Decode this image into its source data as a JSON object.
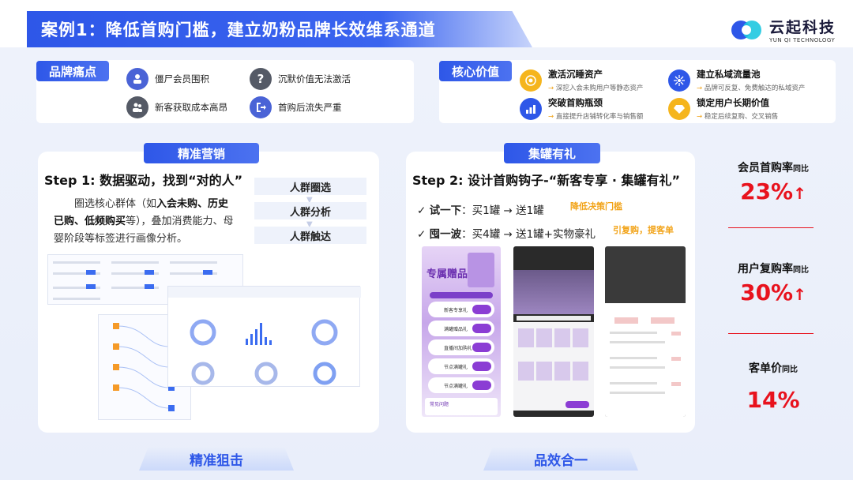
{
  "header": {
    "title": "案例1：降低首购门槛，建立奶粉品牌长效维系通道",
    "logo_cn": "云起科技",
    "logo_en": "YUN QI TECHNOLOGY"
  },
  "pain_points": {
    "label": "品牌痛点",
    "items": [
      {
        "text": "僵尸会员围积",
        "icon": "member-icon",
        "color": "#4a63d6"
      },
      {
        "text": "沉默价值无法激活",
        "icon": "question-icon",
        "color": "#555a66"
      },
      {
        "text": "新客获取成本高昂",
        "icon": "users-icon",
        "color": "#555a66"
      },
      {
        "text": "首购后流失严重",
        "icon": "exit-icon",
        "color": "#4a63d6"
      }
    ]
  },
  "core_value": {
    "label": "核心价值",
    "items": [
      {
        "title": "激活沉睡资产",
        "sub": "深挖入会未购用户等静态资产",
        "icon": "target-icon",
        "color": "#f5b51d"
      },
      {
        "title": "建立私域流量池",
        "sub": "品牌可反复、免费触达的私域资产",
        "icon": "network-icon",
        "color": "#2e57e8"
      },
      {
        "title": "突破首购瓶颈",
        "sub": "直接提升店铺转化率与销售额",
        "icon": "chart-icon",
        "color": "#2e57e8"
      },
      {
        "title": "锁定用户长期价值",
        "sub": "稳定后续复购、交叉销售",
        "icon": "diamond-icon",
        "color": "#f5b51d"
      }
    ],
    "arrow": "→"
  },
  "left_panel": {
    "tag": "精准营销",
    "step": "Step 1: 数据驱动，找到“对的人”",
    "desc_lines": [
      "圈选核心群体（如",
      "入会未购、历史",
      "已购、低频购买",
      "等），叠加消费能力、母婴阶段等标签进行画像分析。"
    ],
    "flow": [
      "人群圈选",
      "人群分析",
      "人群触达"
    ],
    "bottom": "精准狙击"
  },
  "right_panel": {
    "tag": "集罐有礼",
    "step": "Step 2: 设计首购钩子-“新客专享 · 集罐有礼”",
    "offers": [
      {
        "check": "✓",
        "name": "试一下",
        "detail": "：买1罐 → 送1罐",
        "hint": "降低决策门槛"
      },
      {
        "check": "✓",
        "name": "囤一波",
        "detail": "：买4罐 → 送1罐+实物豪礼",
        "hint": "引复购，提客单"
      }
    ],
    "phone_title": "专属赠品礼",
    "phone_rows": [
      "新客专享礼",
      "满罐赠品礼",
      "直播间加购礼",
      "节点满罐礼",
      "节点满罐礼"
    ],
    "phone_faq": "常见问题",
    "bottom": "品效合一"
  },
  "stats": [
    {
      "label": "会员首购率",
      "unit": "同比",
      "value": "23%",
      "arrow": "↑"
    },
    {
      "label": "用户复购率",
      "unit": "同比",
      "value": "30%",
      "arrow": "↑"
    },
    {
      "label": "客单价",
      "unit": "同比",
      "value": "14%",
      "arrow": ""
    }
  ],
  "colors": {
    "brand": "#2e57e8",
    "accent_red": "#e8121d",
    "accent_orange": "#f2a41a"
  }
}
